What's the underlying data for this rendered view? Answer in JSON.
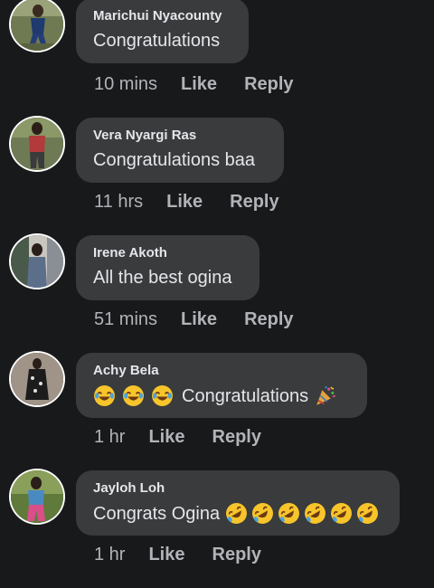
{
  "comments": [
    {
      "author": "Marichui Nyacounty",
      "text": "Congratulations",
      "time": "10 mins",
      "like_label": "Like",
      "reply_label": "Reply"
    },
    {
      "author": "Vera Nyargi Ras",
      "text": "Congratulations baa",
      "time": "11 hrs",
      "like_label": "Like",
      "reply_label": "Reply"
    },
    {
      "author": "Irene Akoth",
      "text": "All the best ogina",
      "time": "51 mins",
      "like_label": "Like",
      "reply_label": "Reply"
    },
    {
      "author": "Achy Bela",
      "text": "Congratulations",
      "time": "1 hr",
      "like_label": "Like",
      "reply_label": "Reply",
      "emojis_before": [
        "joy-emoji",
        "joy-emoji",
        "joy-emoji"
      ],
      "emojis_after": [
        "party-popper-emoji"
      ]
    },
    {
      "author": "Jayloh Loh",
      "text": "Congrats Ogina",
      "time": "1 hr",
      "like_label": "Like",
      "reply_label": "Reply",
      "emojis_after": [
        "rofl-emoji",
        "rofl-emoji",
        "rofl-emoji",
        "rofl-emoji",
        "rofl-emoji",
        "rofl-emoji"
      ]
    }
  ],
  "colors": {
    "background": "#18191a",
    "bubble": "#3a3b3c",
    "primary_text": "#e4e6eb",
    "secondary_text": "#b0b3b8"
  }
}
